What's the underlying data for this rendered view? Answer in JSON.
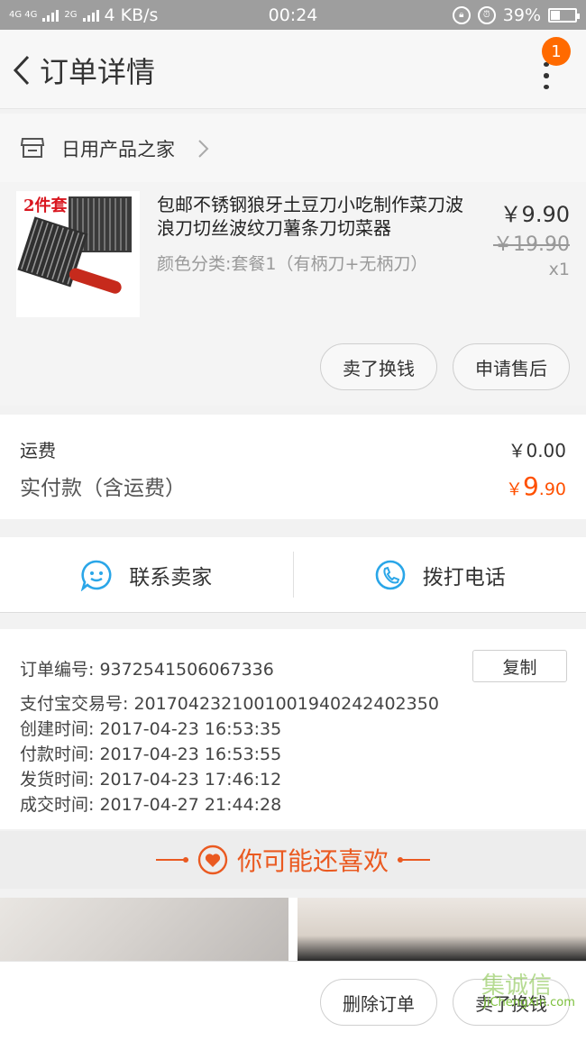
{
  "status_bar": {
    "network": "4G 4G",
    "network2": "2G",
    "speed": "4 KB/s",
    "time": "00:24",
    "battery": "39%",
    "battery_level": 0.39,
    "icons": [
      "signal-icon",
      "lock-rotation-icon",
      "alarm-icon",
      "battery-icon"
    ]
  },
  "nav": {
    "title": "订单详情",
    "badge_count": "1"
  },
  "shop": {
    "name": "日用产品之家"
  },
  "product": {
    "thumb_label": "2件套",
    "title": "包邮不锈钢狼牙土豆刀小吃制作菜刀波浪刀切丝波纹刀薯条刀切菜器",
    "spec": "颜色分类:套餐1（有柄刀+无柄刀）",
    "price": "￥9.90",
    "original_price": "￥19.90",
    "quantity": "x1",
    "actions": [
      "卖了换钱",
      "申请售后"
    ]
  },
  "cost": {
    "shipping_label": "运费",
    "shipping_value": "￥0.00",
    "paid_label": "实付款（含运费）",
    "paid_currency": "￥",
    "paid_int": "9",
    "paid_dec": ".90",
    "accent_color": "#ff5000"
  },
  "contact": {
    "seller": "联系卖家",
    "phone": "拨打电话",
    "icon_color": "#2aa6e8"
  },
  "order_info": {
    "copy_label": "复制",
    "lines": [
      "订单编号:  9372541506067336",
      "支付宝交易号:  2017042321001001940242402350",
      "创建时间:  2017-04-23 16:53:35",
      "付款时间:  2017-04-23 16:53:55",
      "发货时间:  2017-04-23 17:46:12",
      "成交时间:  2017-04-27 21:44:28"
    ]
  },
  "recommend": {
    "title": "你可能还喜欢",
    "color": "#ea5a21"
  },
  "bottom_bar": {
    "delete": "删除订单",
    "sell": "卖了换钱"
  },
  "watermark": {
    "text": "JiChengXin.com",
    "big": "集诚信"
  }
}
